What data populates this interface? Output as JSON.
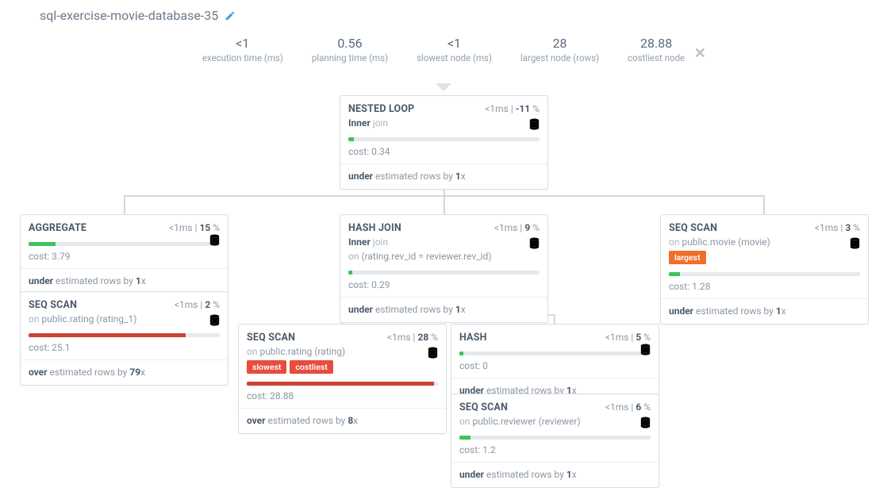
{
  "title": "sql-exercise-movie-database-35",
  "metrics": {
    "exec_time": {
      "val": "<1",
      "label": "execution time (ms)"
    },
    "plan_time": {
      "val": "0.56",
      "label": "planning time (ms)"
    },
    "slowest": {
      "val": "<1",
      "label": "slowest node (ms)"
    },
    "largest": {
      "val": "28",
      "label": "largest node (rows)"
    },
    "costliest": {
      "val": "28.88",
      "label": "costliest node"
    }
  },
  "nodes": {
    "nested": {
      "name": "NESTED LOOP",
      "time": "<1ms",
      "pct": "-11",
      "sub_strong": "Inner",
      "sub_muted": " join",
      "cost": "cost: 0.34",
      "bar_w": "3%",
      "bar_cls": "green",
      "est_b": "under",
      "est_mid": " estimated rows by ",
      "est_x": "1",
      "est_suf": "x"
    },
    "agg": {
      "name": "AGGREGATE",
      "time": "<1ms",
      "pct": "15",
      "cost": "cost: 3.79",
      "bar_w": "14%",
      "bar_cls": "green",
      "est_b": "under",
      "est_mid": " estimated rows by ",
      "est_x": "1",
      "est_suf": "x"
    },
    "seq1": {
      "name": "SEQ SCAN",
      "time": "<1ms",
      "pct": "2",
      "sub_pre": "on ",
      "sub_main": "public.rating (rating_1)",
      "cost": "cost: 25.1",
      "bar_w": "82%",
      "bar_cls": "red",
      "est_b": "over",
      "est_mid": " estimated rows by ",
      "est_x": "79",
      "est_suf": "x"
    },
    "hashj": {
      "name": "HASH JOIN",
      "time": "<1ms",
      "pct": "9",
      "sub_strong": "Inner",
      "sub_muted": " join",
      "sub2_pre": "on ",
      "sub2_main": "(rating.rev_id = reviewer.rev_id)",
      "cost": "cost: 0.29",
      "bar_w": "2%",
      "bar_cls": "green",
      "est_b": "under",
      "est_mid": " estimated rows by ",
      "est_x": "1",
      "est_suf": "x"
    },
    "seq2": {
      "name": "SEQ SCAN",
      "time": "<1ms",
      "pct": "28",
      "sub_pre": "on ",
      "sub_main": "public.rating (rating)",
      "badge1": "slowest",
      "badge2": "costliest",
      "cost": "cost: 28.88",
      "bar_w": "98%",
      "bar_cls": "red",
      "est_b": "over",
      "est_mid": " estimated rows by ",
      "est_x": "8",
      "est_suf": "x"
    },
    "hash": {
      "name": "HASH",
      "time": "<1ms",
      "pct": "5",
      "cost": "cost: 0",
      "bar_w": "2%",
      "bar_cls": "green",
      "est_b": "under",
      "est_mid": " estimated rows by ",
      "est_x": "1",
      "est_suf": "x"
    },
    "seq3": {
      "name": "SEQ SCAN",
      "time": "<1ms",
      "pct": "6",
      "sub_pre": "on ",
      "sub_main": "public.reviewer (reviewer)",
      "cost": "cost: 1.2",
      "bar_w": "6%",
      "bar_cls": "green",
      "est_b": "under",
      "est_mid": " estimated rows by ",
      "est_x": "1",
      "est_suf": "x"
    },
    "seq4": {
      "name": "SEQ SCAN",
      "time": "<1ms",
      "pct": "3",
      "sub_pre": "on ",
      "sub_main": "public.movie (movie)",
      "badge1": "largest",
      "cost": "cost: 1.28",
      "bar_w": "6%",
      "bar_cls": "green",
      "est_b": "under",
      "est_mid": " estimated rows by ",
      "est_x": "1",
      "est_suf": "x"
    }
  }
}
